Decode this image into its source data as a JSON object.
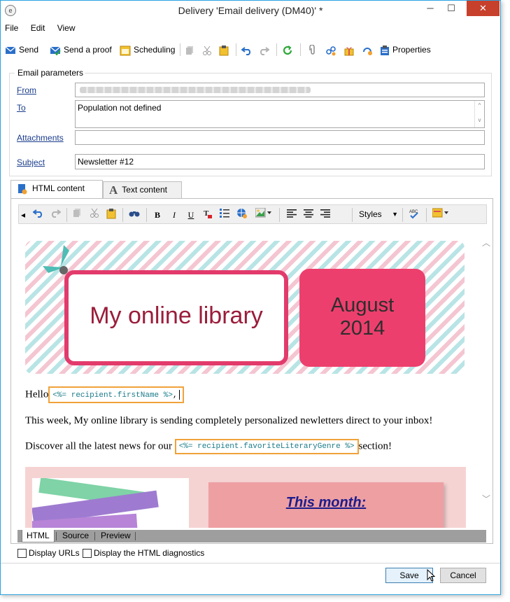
{
  "window": {
    "title": "Delivery 'Email delivery (DM40)' *",
    "app_icon": "e",
    "minimize": "─",
    "maximize": "☐",
    "close": "✕"
  },
  "menu": [
    "File",
    "Edit",
    "View"
  ],
  "toolbar": {
    "send": "Send",
    "send_proof": "Send a proof",
    "scheduling": "Scheduling",
    "properties": "Properties"
  },
  "params": {
    "legend": "Email parameters",
    "from_label": "From",
    "to_label": "To",
    "to_value": "Population not defined",
    "attachments_label": "Attachments",
    "attachments_value": "",
    "subject_label": "Subject",
    "subject_value": "Newsletter #12"
  },
  "tabs": {
    "html": "HTML content",
    "text": "Text content"
  },
  "editor_toolbar": {
    "bold": "B",
    "italic": "I",
    "underline": "U",
    "styles": "Styles"
  },
  "content": {
    "banner_title": "My online library",
    "banner_month": "August",
    "banner_year": "2014",
    "hello": "Hello",
    "firstname_tag": "<%= recipient.firstName %>",
    "hello_suffix": ",",
    "para1": "This week, My online library is sending completely personalized newletters direct to your inbox!",
    "para2_pre": "Discover all the latest news for our",
    "genre_tag": "<%= recipient.favoriteLiteraryGenre %>",
    "para2_post": "section!",
    "this_month": "This month:"
  },
  "bottom_tabs": [
    "HTML",
    "Source",
    "Preview"
  ],
  "checkboxes": {
    "display_urls": "Display URLs",
    "display_diag": "Display the HTML diagnostics"
  },
  "buttons": {
    "save": "Save",
    "cancel": "Cancel"
  },
  "colors": {
    "accent_pink": "#ed3f6d",
    "title_red": "#9a1d3a",
    "tag_border": "#f1a239",
    "tag_text": "#1b7b8a",
    "link_blue": "#1a3d8c"
  }
}
